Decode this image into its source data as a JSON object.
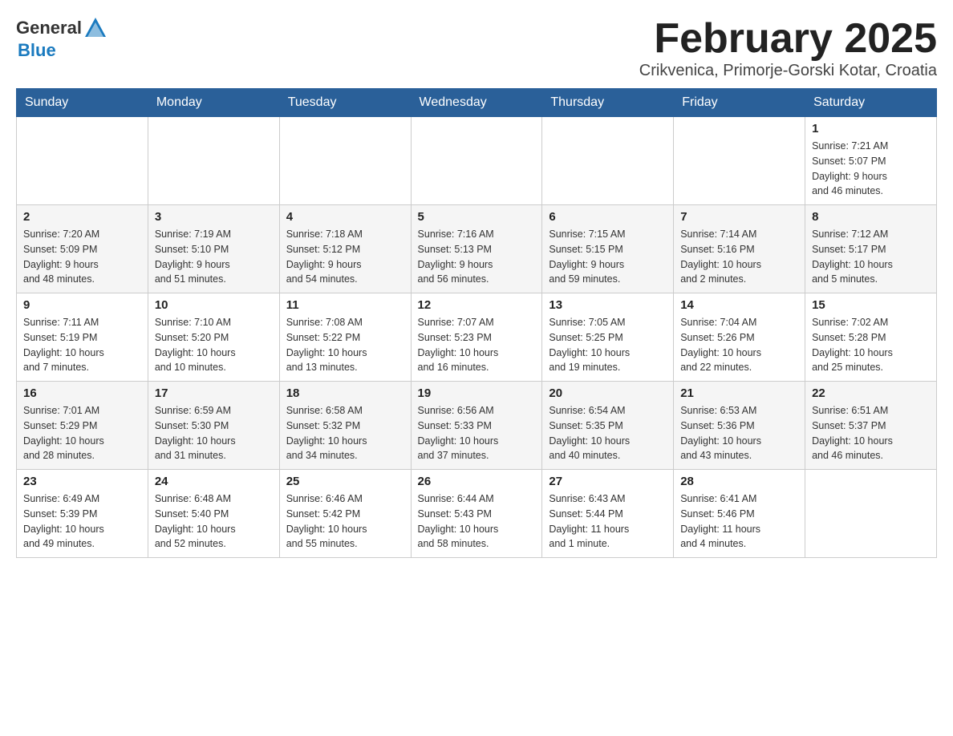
{
  "header": {
    "logo_general": "General",
    "logo_blue": "Blue",
    "month_title": "February 2025",
    "subtitle": "Crikvenica, Primorje-Gorski Kotar, Croatia"
  },
  "days_of_week": [
    "Sunday",
    "Monday",
    "Tuesday",
    "Wednesday",
    "Thursday",
    "Friday",
    "Saturday"
  ],
  "weeks": [
    [
      {
        "day": "",
        "info": ""
      },
      {
        "day": "",
        "info": ""
      },
      {
        "day": "",
        "info": ""
      },
      {
        "day": "",
        "info": ""
      },
      {
        "day": "",
        "info": ""
      },
      {
        "day": "",
        "info": ""
      },
      {
        "day": "1",
        "info": "Sunrise: 7:21 AM\nSunset: 5:07 PM\nDaylight: 9 hours\nand 46 minutes."
      }
    ],
    [
      {
        "day": "2",
        "info": "Sunrise: 7:20 AM\nSunset: 5:09 PM\nDaylight: 9 hours\nand 48 minutes."
      },
      {
        "day": "3",
        "info": "Sunrise: 7:19 AM\nSunset: 5:10 PM\nDaylight: 9 hours\nand 51 minutes."
      },
      {
        "day": "4",
        "info": "Sunrise: 7:18 AM\nSunset: 5:12 PM\nDaylight: 9 hours\nand 54 minutes."
      },
      {
        "day": "5",
        "info": "Sunrise: 7:16 AM\nSunset: 5:13 PM\nDaylight: 9 hours\nand 56 minutes."
      },
      {
        "day": "6",
        "info": "Sunrise: 7:15 AM\nSunset: 5:15 PM\nDaylight: 9 hours\nand 59 minutes."
      },
      {
        "day": "7",
        "info": "Sunrise: 7:14 AM\nSunset: 5:16 PM\nDaylight: 10 hours\nand 2 minutes."
      },
      {
        "day": "8",
        "info": "Sunrise: 7:12 AM\nSunset: 5:17 PM\nDaylight: 10 hours\nand 5 minutes."
      }
    ],
    [
      {
        "day": "9",
        "info": "Sunrise: 7:11 AM\nSunset: 5:19 PM\nDaylight: 10 hours\nand 7 minutes."
      },
      {
        "day": "10",
        "info": "Sunrise: 7:10 AM\nSunset: 5:20 PM\nDaylight: 10 hours\nand 10 minutes."
      },
      {
        "day": "11",
        "info": "Sunrise: 7:08 AM\nSunset: 5:22 PM\nDaylight: 10 hours\nand 13 minutes."
      },
      {
        "day": "12",
        "info": "Sunrise: 7:07 AM\nSunset: 5:23 PM\nDaylight: 10 hours\nand 16 minutes."
      },
      {
        "day": "13",
        "info": "Sunrise: 7:05 AM\nSunset: 5:25 PM\nDaylight: 10 hours\nand 19 minutes."
      },
      {
        "day": "14",
        "info": "Sunrise: 7:04 AM\nSunset: 5:26 PM\nDaylight: 10 hours\nand 22 minutes."
      },
      {
        "day": "15",
        "info": "Sunrise: 7:02 AM\nSunset: 5:28 PM\nDaylight: 10 hours\nand 25 minutes."
      }
    ],
    [
      {
        "day": "16",
        "info": "Sunrise: 7:01 AM\nSunset: 5:29 PM\nDaylight: 10 hours\nand 28 minutes."
      },
      {
        "day": "17",
        "info": "Sunrise: 6:59 AM\nSunset: 5:30 PM\nDaylight: 10 hours\nand 31 minutes."
      },
      {
        "day": "18",
        "info": "Sunrise: 6:58 AM\nSunset: 5:32 PM\nDaylight: 10 hours\nand 34 minutes."
      },
      {
        "day": "19",
        "info": "Sunrise: 6:56 AM\nSunset: 5:33 PM\nDaylight: 10 hours\nand 37 minutes."
      },
      {
        "day": "20",
        "info": "Sunrise: 6:54 AM\nSunset: 5:35 PM\nDaylight: 10 hours\nand 40 minutes."
      },
      {
        "day": "21",
        "info": "Sunrise: 6:53 AM\nSunset: 5:36 PM\nDaylight: 10 hours\nand 43 minutes."
      },
      {
        "day": "22",
        "info": "Sunrise: 6:51 AM\nSunset: 5:37 PM\nDaylight: 10 hours\nand 46 minutes."
      }
    ],
    [
      {
        "day": "23",
        "info": "Sunrise: 6:49 AM\nSunset: 5:39 PM\nDaylight: 10 hours\nand 49 minutes."
      },
      {
        "day": "24",
        "info": "Sunrise: 6:48 AM\nSunset: 5:40 PM\nDaylight: 10 hours\nand 52 minutes."
      },
      {
        "day": "25",
        "info": "Sunrise: 6:46 AM\nSunset: 5:42 PM\nDaylight: 10 hours\nand 55 minutes."
      },
      {
        "day": "26",
        "info": "Sunrise: 6:44 AM\nSunset: 5:43 PM\nDaylight: 10 hours\nand 58 minutes."
      },
      {
        "day": "27",
        "info": "Sunrise: 6:43 AM\nSunset: 5:44 PM\nDaylight: 11 hours\nand 1 minute."
      },
      {
        "day": "28",
        "info": "Sunrise: 6:41 AM\nSunset: 5:46 PM\nDaylight: 11 hours\nand 4 minutes."
      },
      {
        "day": "",
        "info": ""
      }
    ]
  ]
}
